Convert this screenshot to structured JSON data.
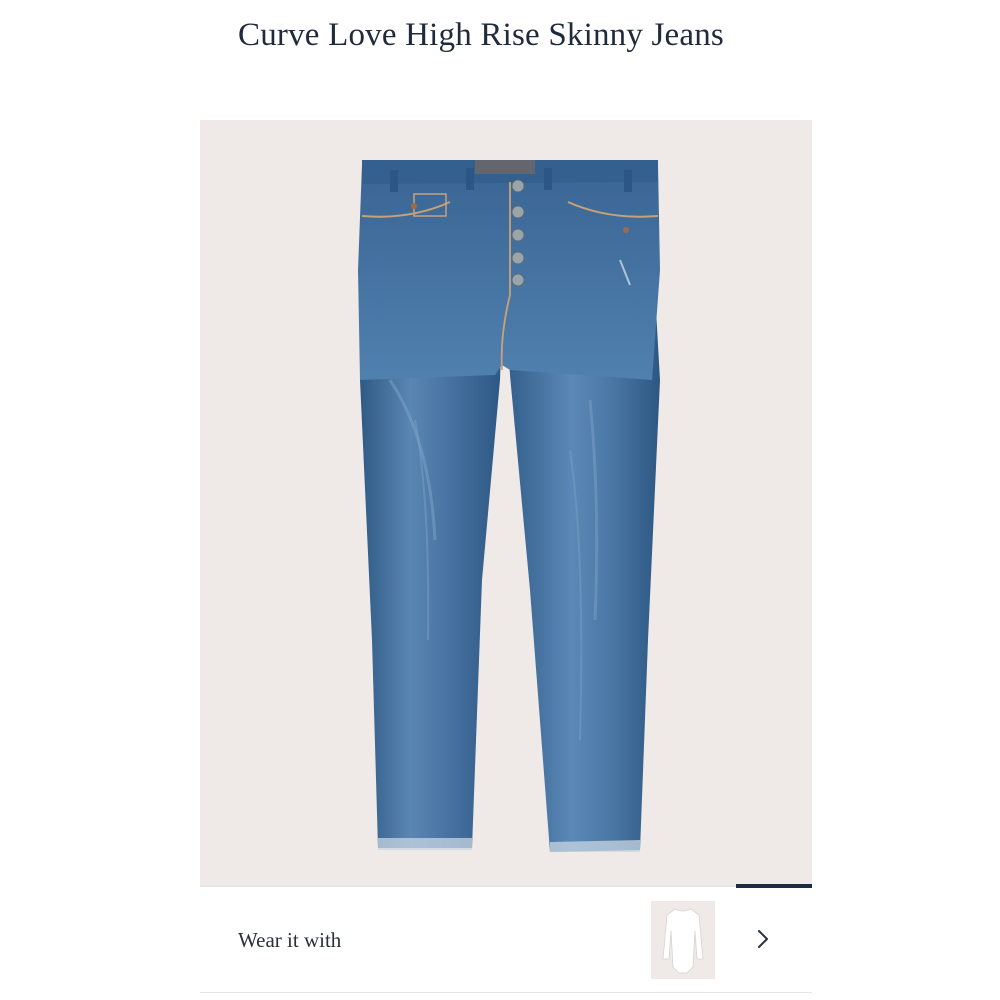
{
  "product": {
    "title": "Curve Love High Rise Skinny Jeans",
    "image": {
      "subject": "high-rise-skinny-jeans-medium-wash",
      "background_color": "#efe9e7",
      "denim_color": "#3e6a98"
    }
  },
  "carousel": {
    "active_index": 4,
    "indicator_color": "#1f2a44"
  },
  "wear_it_with": {
    "label": "Wear it with",
    "items": [
      {
        "icon": "white-bodysuit-thumbnail"
      }
    ],
    "next_icon": "chevron-right-icon"
  },
  "colors": {
    "title": "#1f2a3a",
    "text": "#2a2f3a",
    "divider": "#e3e3e3"
  }
}
